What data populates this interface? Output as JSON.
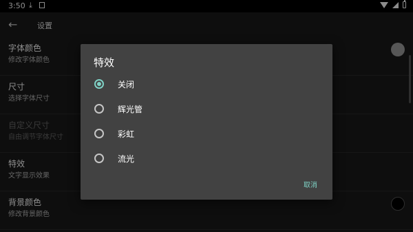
{
  "statusbar": {
    "time": "3:50"
  },
  "appbar": {
    "title": "设置"
  },
  "settings": [
    {
      "title": "字体颜色",
      "subtitle": "修改字体颜色"
    },
    {
      "title": "尺寸",
      "subtitle": "选择字体尺寸"
    },
    {
      "title": "自定义尺寸",
      "subtitle": "自由调节字体尺寸"
    },
    {
      "title": "特效",
      "subtitle": "文字显示效果"
    },
    {
      "title": "背景颜色",
      "subtitle": "修改背景颜色"
    }
  ],
  "colors": {
    "font_swatch": "#9e9e9e",
    "bg_swatch": "#000000",
    "accent": "#7fd1c5"
  },
  "dialog": {
    "title": "特效",
    "options": [
      "关闭",
      "辉光管",
      "彩虹",
      "流光"
    ],
    "selected": "关闭",
    "cancel_label": "取消"
  }
}
